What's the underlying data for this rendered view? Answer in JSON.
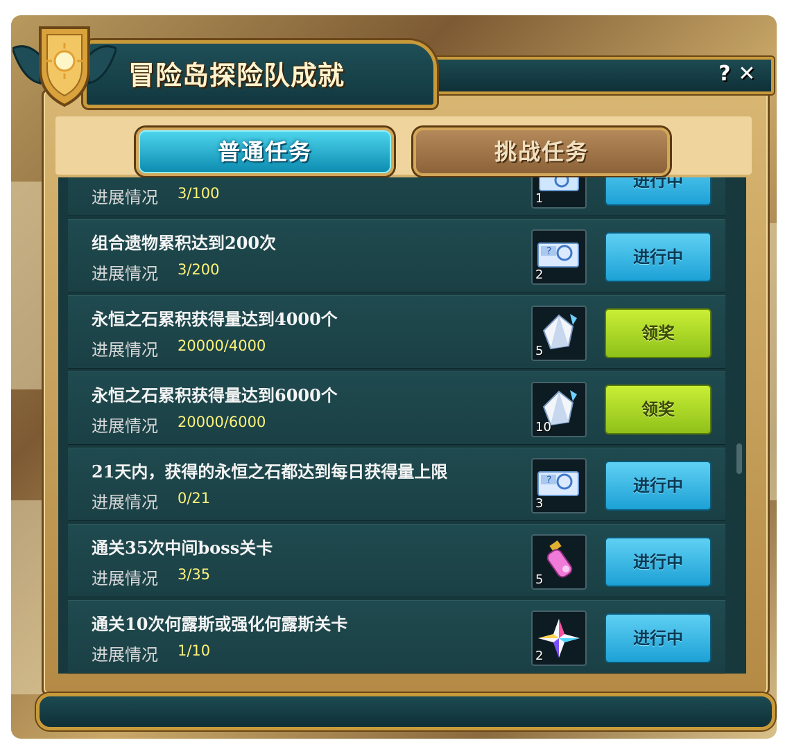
{
  "window": {
    "title": "冒险岛探险队成就",
    "help_label": "?",
    "close_label": "✕"
  },
  "tabs": [
    {
      "label": "普通任务",
      "active": true
    },
    {
      "label": "挑战任务",
      "active": false
    }
  ],
  "progress_label": "进展情况",
  "tasks": [
    {
      "title": "",
      "progress": "3/100",
      "icon": "ticket-icon",
      "count": "1",
      "button": "进行中",
      "status": "in-progress"
    },
    {
      "title": "组合遗物累积达到200次",
      "progress": "3/200",
      "icon": "ticket-icon",
      "count": "2",
      "button": "进行中",
      "status": "in-progress"
    },
    {
      "title": "永恒之石累积获得量达到4000个",
      "progress": "20000/4000",
      "icon": "crystal-stone-icon",
      "count": "5",
      "button": "领奖",
      "status": "claim"
    },
    {
      "title": "永恒之石累积获得量达到6000个",
      "progress": "20000/6000",
      "icon": "crystal-stone-icon",
      "count": "10",
      "button": "领奖",
      "status": "claim"
    },
    {
      "title": "21天内，获得的永恒之石都达到每日获得量上限",
      "progress": "0/21",
      "icon": "ticket-icon",
      "count": "3",
      "button": "进行中",
      "status": "in-progress"
    },
    {
      "title": "通关35次中间boss关卡",
      "progress": "3/35",
      "icon": "potion-icon",
      "count": "5",
      "button": "进行中",
      "status": "in-progress"
    },
    {
      "title": "通关10次何露斯或强化何露斯关卡",
      "progress": "1/10",
      "icon": "rainbow-gem-icon",
      "count": "2",
      "button": "进行中",
      "status": "in-progress"
    }
  ],
  "colors": {
    "panel": "#17393e",
    "progress_value": "#fff27a",
    "button_progress": "#1da1d6",
    "button_claim": "#8fc11a",
    "frame_gold": "#c89a3a"
  }
}
